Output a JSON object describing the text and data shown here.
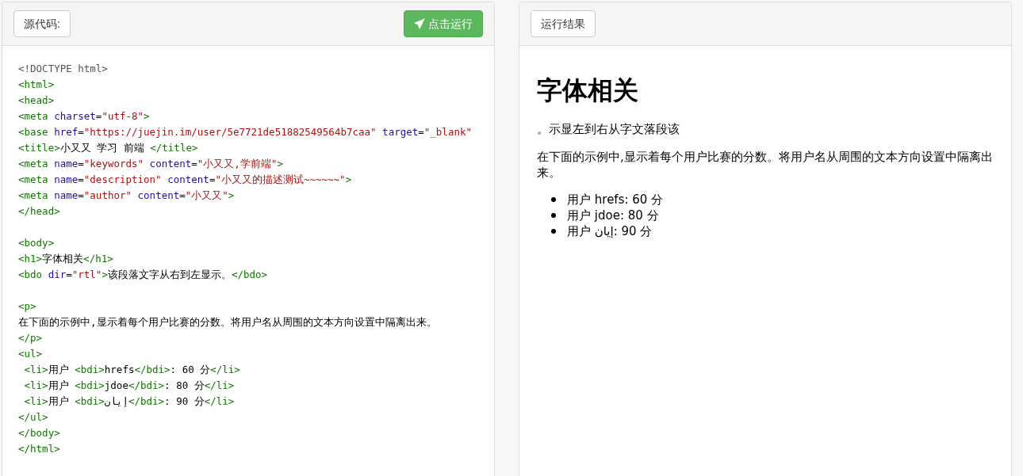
{
  "source_panel": {
    "label": "源代码:",
    "run_button": "点击运行",
    "code_lines": [
      {
        "tokens": [
          {
            "kind": "meta",
            "text": "<!DOCTYPE html>"
          }
        ]
      },
      {
        "tokens": [
          {
            "kind": "tag",
            "text": "<html>"
          }
        ]
      },
      {
        "tokens": [
          {
            "kind": "tag",
            "text": "<head>"
          }
        ]
      },
      {
        "tokens": [
          {
            "kind": "tag",
            "text": "<meta"
          },
          {
            "kind": "attr",
            "text": " charset"
          },
          {
            "kind": "plain",
            "text": "="
          },
          {
            "kind": "value",
            "text": "\"utf-8\""
          },
          {
            "kind": "tag",
            "text": ">"
          }
        ]
      },
      {
        "tokens": [
          {
            "kind": "tag",
            "text": "<base"
          },
          {
            "kind": "attr",
            "text": " href"
          },
          {
            "kind": "plain",
            "text": "="
          },
          {
            "kind": "value",
            "text": "\"https://juejin.im/user/5e7721de51882549564b7caa\""
          },
          {
            "kind": "attr",
            "text": " target"
          },
          {
            "kind": "plain",
            "text": "="
          },
          {
            "kind": "value",
            "text": "\"_blank\""
          }
        ]
      },
      {
        "tokens": [
          {
            "kind": "tag",
            "text": "<title>"
          },
          {
            "kind": "text",
            "text": "小又又 学习 前端 "
          },
          {
            "kind": "tag",
            "text": "</title>"
          }
        ]
      },
      {
        "tokens": [
          {
            "kind": "tag",
            "text": "<meta"
          },
          {
            "kind": "attr",
            "text": " name"
          },
          {
            "kind": "plain",
            "text": "="
          },
          {
            "kind": "value",
            "text": "\"keywords\""
          },
          {
            "kind": "attr",
            "text": " content"
          },
          {
            "kind": "plain",
            "text": "="
          },
          {
            "kind": "value",
            "text": "\"小又又,学前端\""
          },
          {
            "kind": "tag",
            "text": ">"
          }
        ]
      },
      {
        "tokens": [
          {
            "kind": "tag",
            "text": "<meta"
          },
          {
            "kind": "attr",
            "text": " name"
          },
          {
            "kind": "plain",
            "text": "="
          },
          {
            "kind": "value",
            "text": "\"description\""
          },
          {
            "kind": "attr",
            "text": " content"
          },
          {
            "kind": "plain",
            "text": "="
          },
          {
            "kind": "value",
            "text": "\"小又又的描述测试~~~~~~\""
          },
          {
            "kind": "tag",
            "text": ">"
          }
        ]
      },
      {
        "tokens": [
          {
            "kind": "tag",
            "text": "<meta"
          },
          {
            "kind": "attr",
            "text": " name"
          },
          {
            "kind": "plain",
            "text": "="
          },
          {
            "kind": "value",
            "text": "\"author\""
          },
          {
            "kind": "attr",
            "text": " content"
          },
          {
            "kind": "plain",
            "text": "="
          },
          {
            "kind": "value",
            "text": "\"小又又\""
          },
          {
            "kind": "tag",
            "text": ">"
          }
        ]
      },
      {
        "tokens": [
          {
            "kind": "tag",
            "text": "</head>"
          }
        ]
      },
      {
        "gap_before": true,
        "tokens": [
          {
            "kind": "tag",
            "text": "<body>"
          }
        ]
      },
      {
        "tokens": [
          {
            "kind": "tag",
            "text": "<h1>"
          },
          {
            "kind": "text",
            "text": "字体相关"
          },
          {
            "kind": "tag",
            "text": "</h1>"
          }
        ]
      },
      {
        "tokens": [
          {
            "kind": "tag",
            "text": "<bdo"
          },
          {
            "kind": "attr",
            "text": " dir"
          },
          {
            "kind": "plain",
            "text": "="
          },
          {
            "kind": "value",
            "text": "\"rtl\""
          },
          {
            "kind": "tag",
            "text": ">"
          },
          {
            "kind": "text",
            "text": "该段落文字从右到左显示。"
          },
          {
            "kind": "tag",
            "text": "</bdo>"
          }
        ]
      },
      {
        "gap_before": true,
        "tokens": [
          {
            "kind": "tag",
            "text": "<p>"
          }
        ]
      },
      {
        "tokens": [
          {
            "kind": "text",
            "text": "在下面的示例中,显示着每个用户比赛的分数。将用户名从周围的文本方向设置中隔离出来。"
          }
        ]
      },
      {
        "tokens": [
          {
            "kind": "tag",
            "text": "</p>"
          }
        ]
      },
      {
        "tokens": [
          {
            "kind": "tag",
            "text": "<ul>"
          }
        ]
      },
      {
        "tokens": [
          {
            "kind": "tag",
            "text": " <li>"
          },
          {
            "kind": "text",
            "text": "用户 "
          },
          {
            "kind": "tag",
            "text": "<bdi>"
          },
          {
            "kind": "text",
            "text": "hrefs"
          },
          {
            "kind": "tag",
            "text": "</bdi>"
          },
          {
            "kind": "text",
            "text": ": 60 分"
          },
          {
            "kind": "tag",
            "text": "</li>"
          }
        ]
      },
      {
        "tokens": [
          {
            "kind": "tag",
            "text": " <li>"
          },
          {
            "kind": "text",
            "text": "用户 "
          },
          {
            "kind": "tag",
            "text": "<bdi>"
          },
          {
            "kind": "text",
            "text": "jdoe"
          },
          {
            "kind": "tag",
            "text": "</bdi>"
          },
          {
            "kind": "text",
            "text": ": 80 分"
          },
          {
            "kind": "tag",
            "text": "</li>"
          }
        ]
      },
      {
        "tokens": [
          {
            "kind": "tag",
            "text": " <li>"
          },
          {
            "kind": "text",
            "text": "用户 "
          },
          {
            "kind": "tag",
            "text": "<bdi>"
          },
          {
            "kind": "text",
            "text": "إيان"
          },
          {
            "kind": "tag",
            "text": "</bdi>"
          },
          {
            "kind": "text",
            "text": ": 90 分"
          },
          {
            "kind": "tag",
            "text": "</li>"
          }
        ]
      },
      {
        "tokens": [
          {
            "kind": "tag",
            "text": "</ul>"
          }
        ]
      },
      {
        "tokens": [
          {
            "kind": "tag",
            "text": "</body>"
          }
        ]
      },
      {
        "tokens": [
          {
            "kind": "tag",
            "text": "</html>"
          }
        ]
      }
    ]
  },
  "result_panel": {
    "label": "运行结果",
    "heading": "字体相关",
    "rtl_line": "。示显左到右从字文落段该",
    "paragraph": "在下面的示例中,显示着每个用户比赛的分数。将用户名从周围的文本方向设置中隔离出来。",
    "list_items": [
      {
        "prefix": "用户 ",
        "name": "hrefs",
        "suffix": ": 60 分"
      },
      {
        "prefix": "用户 ",
        "name": "jdoe",
        "suffix": ": 80 分"
      },
      {
        "prefix": "用户 ",
        "name": "إيان",
        "suffix": ": 90 分"
      }
    ]
  }
}
